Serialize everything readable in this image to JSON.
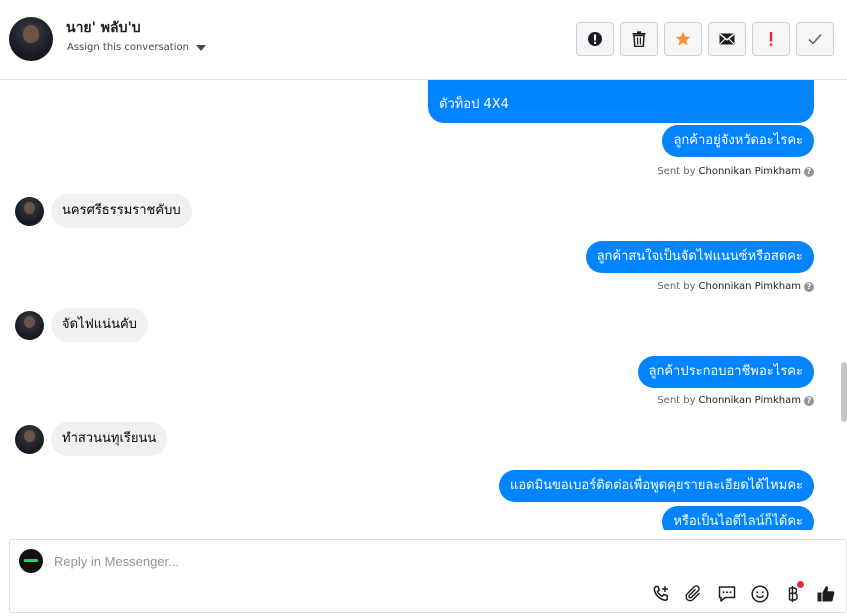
{
  "header": {
    "contact_name": "นาย' พลับ'บ",
    "assign_label": "Assign this conversation",
    "toolbar": [
      {
        "name": "spam-button",
        "icon": "alert-circle-icon"
      },
      {
        "name": "delete-button",
        "icon": "trash-icon"
      },
      {
        "name": "star-button",
        "icon": "star-icon"
      },
      {
        "name": "mark-unread-button",
        "icon": "envelope-icon"
      },
      {
        "name": "follow-up-button",
        "icon": "exclamation-icon"
      },
      {
        "name": "mark-done-button",
        "icon": "checkmark-icon"
      }
    ]
  },
  "messages": {
    "m1": "ตัวท็อป 4X4",
    "m2": "ลูกค้าอยู่จังหวัดอะไรคะ",
    "m3": "นครศรีธรรมราชคับบ",
    "m4": "ลูกค้าสนใจเป็นจัดไฟแนนซ์หรือสดคะ",
    "m5": "จัดไฟแน่นคับ",
    "m6": "ลูกค้าประกอบอาชีพอะไรคะ",
    "m7": "ทำสวนนทุเรียนน",
    "m8": "แอดมินขอเบอร์ติดต่อเพื่อพูดคุยรายละเอียดได้ไหมคะ",
    "m9": "หรือเป็นไอดีไลน์ก็ได้คะ"
  },
  "sent_by": {
    "prefix": "Sent by",
    "agent": "Chonnikan Pimkham",
    "help": "?"
  },
  "composer": {
    "placeholder": "Reply in Messenger..."
  },
  "colors": {
    "outgoing_bubble": "#0084ff",
    "incoming_bubble": "#f0f0f0",
    "star": "#f7923b",
    "alert": "#e4252b"
  }
}
